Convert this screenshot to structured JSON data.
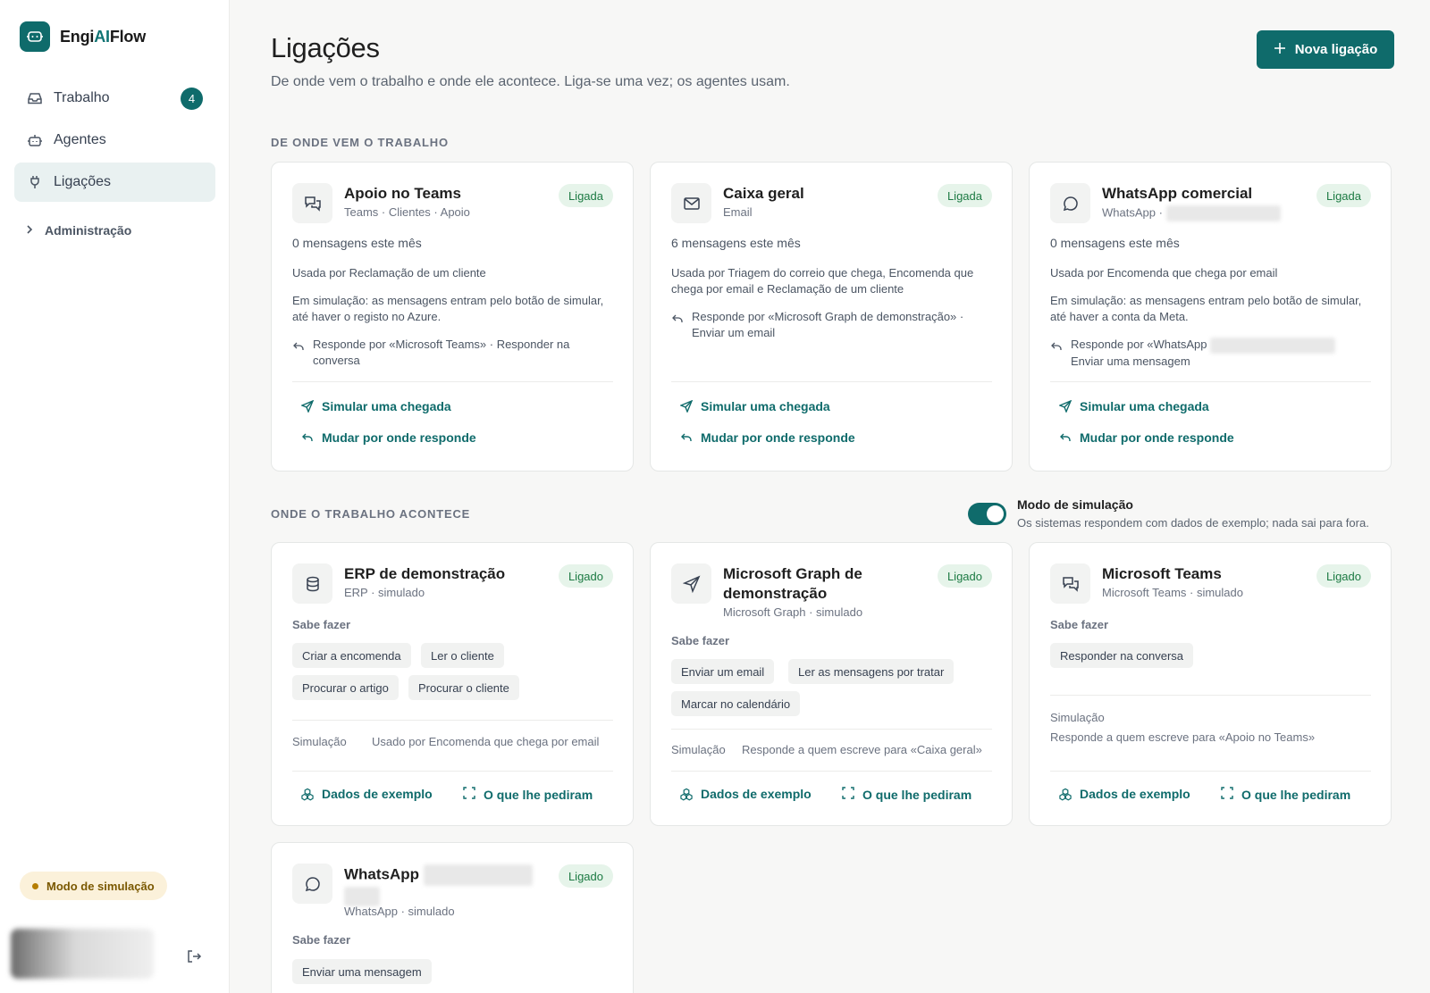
{
  "brand": {
    "name_prefix": "Engi",
    "name_ai": "AI",
    "name_suffix": "Flow"
  },
  "sidebar": {
    "items": [
      {
        "label": "Trabalho",
        "badge": "4",
        "icon": "inbox-icon"
      },
      {
        "label": "Agentes",
        "icon": "robot-icon"
      },
      {
        "label": "Ligações",
        "icon": "plug-icon",
        "active": true
      }
    ],
    "admin_label": "Administração",
    "sim_pill": "Modo de simulação"
  },
  "header": {
    "title": "Ligações",
    "subtitle": "De onde vem o trabalho e onde ele acontece. Liga-se uma vez; os agentes usam.",
    "new_button": "Nova ligação"
  },
  "sources": {
    "section_label": "DE ONDE VEM O TRABALHO",
    "cards": [
      {
        "title": "Apoio no Teams",
        "subtitle": "Teams · Clientes · Apoio",
        "status": "Ligada",
        "count": "0 mensagens este mês",
        "used_by": "Usada por Reclamação de um cliente",
        "sim_note": "Em simulação: as mensagens entram pelo botão de simular, até haver o registo no Azure.",
        "reply": "Responde por «Microsoft Teams» · Responder na conversa",
        "action_simulate": "Simular uma chegada",
        "action_change": "Mudar por onde responde"
      },
      {
        "title": "Caixa geral",
        "subtitle": "Email",
        "status": "Ligada",
        "count": "6 mensagens este mês",
        "used_by": "Usada por Triagem do correio que chega, Encomenda que chega por email e Reclamação de um cliente",
        "reply": "Responde por «Microsoft Graph de demonstração» · Enviar um email",
        "action_simulate": "Simular uma chegada",
        "action_change": "Mudar por onde responde"
      },
      {
        "title": "WhatsApp comercial",
        "subtitle": "WhatsApp ·",
        "status": "Ligada",
        "count": "0 mensagens este mês",
        "used_by": "Usada por Encomenda que chega por email",
        "sim_note": "Em simulação: as mensagens entram pelo botão de simular, até haver a conta da Meta.",
        "reply_line1": "Responde por «WhatsApp",
        "reply_line2": "Enviar uma mensagem",
        "action_simulate": "Simular uma chegada",
        "action_change": "Mudar por onde responde"
      }
    ]
  },
  "targets": {
    "section_label": "ONDE O TRABALHO ACONTECE",
    "toggle_title": "Modo de simulação",
    "toggle_sub": "Os sistemas respondem com dados de exemplo; nada sai para fora.",
    "sabe_fazer": "Sabe fazer",
    "sim_key": "Simulação",
    "action_data": "Dados de exemplo",
    "action_asked": "O que lhe pediram",
    "cards": [
      {
        "title": "ERP de demonstração",
        "subtitle": "ERP · simulado",
        "status": "Ligado",
        "chips": [
          "Criar a encomenda",
          "Ler o cliente",
          "Procurar o artigo",
          "Procurar o cliente"
        ],
        "sim_value": "Usado por Encomenda que chega por email"
      },
      {
        "title_line1": "Microsoft Graph de",
        "title_line2": "demonstração",
        "subtitle": "Microsoft Graph · simulado",
        "status": "Ligado",
        "chips": [
          "Enviar um email",
          "Ler as mensagens por tratar",
          "Marcar no calendário"
        ],
        "sim_value": "Responde a quem escreve para «Caixa geral»"
      },
      {
        "title": "Microsoft Teams",
        "subtitle": "Microsoft Teams · simulado",
        "status": "Ligado",
        "chips": [
          "Responder na conversa"
        ],
        "sim_value": "Responde a quem escreve para «Apoio no Teams»"
      },
      {
        "title": "WhatsApp",
        "subtitle": "WhatsApp · simulado",
        "status": "Ligado",
        "chips": [
          "Enviar uma mensagem"
        ]
      }
    ]
  },
  "colors": {
    "accent": "#0f6b6b",
    "status_bg": "#e6f4ea",
    "status_text": "#1c7a43",
    "sim_pill_bg": "#fbf1da"
  }
}
